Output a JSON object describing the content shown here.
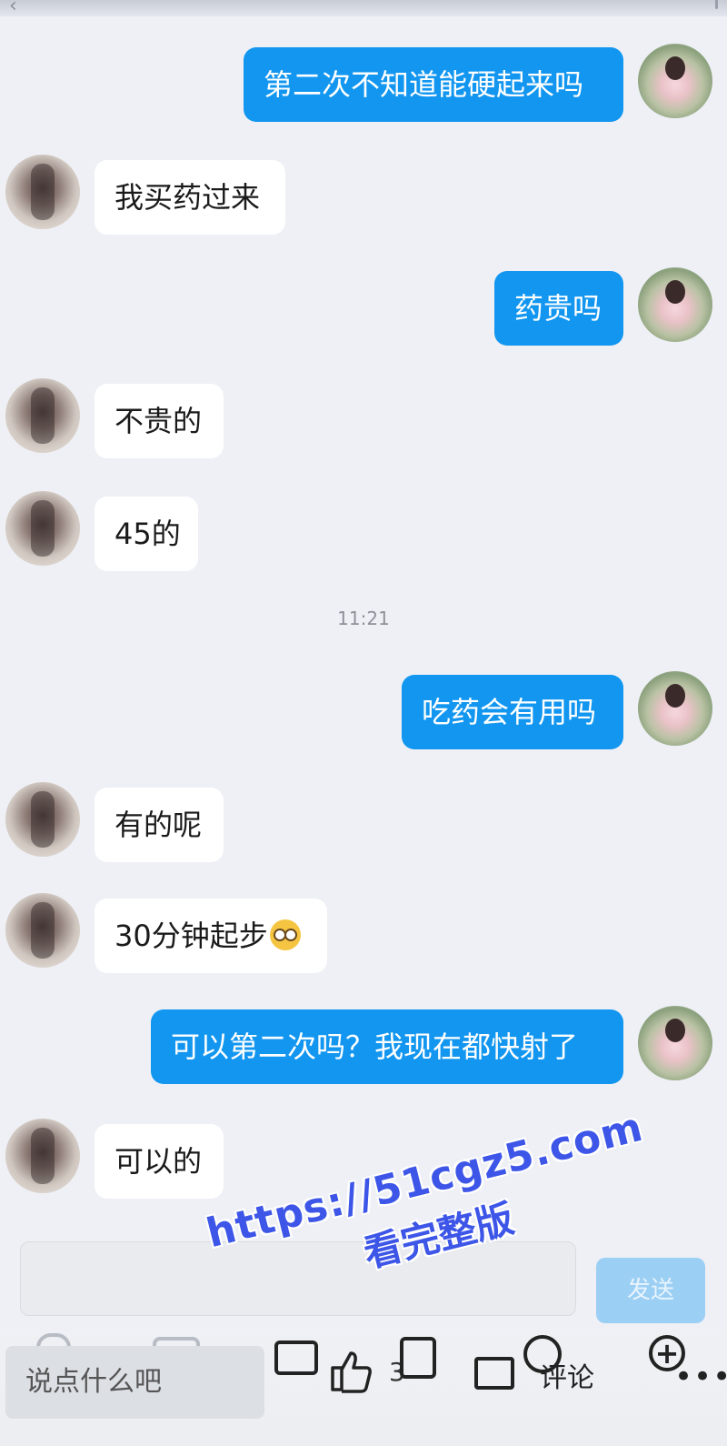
{
  "messages": [
    {
      "from": "me",
      "text": "第二次不知道能硬起来吗"
    },
    {
      "from": "her",
      "text": "我买药过来"
    },
    {
      "from": "me",
      "text": "药贵吗"
    },
    {
      "from": "her",
      "text": "不贵的"
    },
    {
      "from": "her",
      "text": "45的"
    },
    {
      "from": "me",
      "text": "吃药会有用吗"
    },
    {
      "from": "her",
      "text": "有的呢"
    },
    {
      "from": "her",
      "text": "30分钟起步",
      "emoji": "flushed-face"
    },
    {
      "from": "me",
      "text": "可以第二次吗？我现在都快射了"
    },
    {
      "from": "her",
      "text": "可以的"
    }
  ],
  "timestamp": "11:21",
  "composer": {
    "send_label": "发送"
  },
  "bottom_bar": {
    "comment_placeholder": "说点什么吧",
    "like_count": "3",
    "comment_label": "评论"
  },
  "watermark": {
    "url": "https://51cgz5.com",
    "subtitle": "看完整版"
  },
  "colors": {
    "outgoing_bubble": "#1296f0",
    "incoming_bubble": "#ffffff",
    "background": "#eef0f5",
    "watermark": "#3d56e8"
  }
}
